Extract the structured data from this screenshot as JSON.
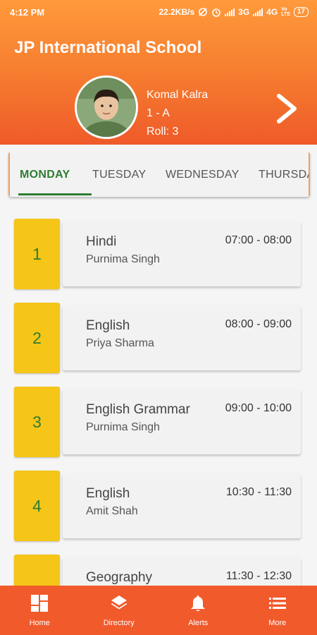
{
  "status_bar": {
    "time": "4:12 PM",
    "speed": "22.2KB/s",
    "network_3g": "3G",
    "network_4g": "4G",
    "battery": "17"
  },
  "header": {
    "school_name": "JP International School"
  },
  "student": {
    "name": "Komal Kalra",
    "class": "1 - A",
    "roll": "Roll: 3"
  },
  "tabs": [
    {
      "label": "MONDAY",
      "active": true
    },
    {
      "label": "TUESDAY",
      "active": false
    },
    {
      "label": "WEDNESDAY",
      "active": false
    },
    {
      "label": "THURSDAY",
      "active": false
    }
  ],
  "periods": [
    {
      "number": "1",
      "subject": "Hindi",
      "teacher": "Purnima Singh",
      "time": "07:00 - 08:00"
    },
    {
      "number": "2",
      "subject": "English",
      "teacher": "Priya Sharma",
      "time": "08:00 - 09:00"
    },
    {
      "number": "3",
      "subject": "English Grammar",
      "teacher": "Purnima Singh",
      "time": "09:00 - 10:00"
    },
    {
      "number": "4",
      "subject": "English",
      "teacher": "Amit Shah",
      "time": "10:30 - 11:30"
    },
    {
      "number": "5",
      "subject": "Geography",
      "teacher": "",
      "time": "11:30 - 12:30"
    }
  ],
  "bottom_nav": [
    {
      "label": "Home",
      "icon": "dashboard-icon"
    },
    {
      "label": "Directory",
      "icon": "layers-icon"
    },
    {
      "label": "Alerts",
      "icon": "bell-icon"
    },
    {
      "label": "More",
      "icon": "list-icon"
    }
  ],
  "colors": {
    "header_top": "#ff9a3c",
    "header_bottom": "#ef5a2a",
    "period_number_bg": "#f5c518",
    "active_green": "#2e7d32",
    "bottom_nav_bg": "#f15a2b"
  }
}
